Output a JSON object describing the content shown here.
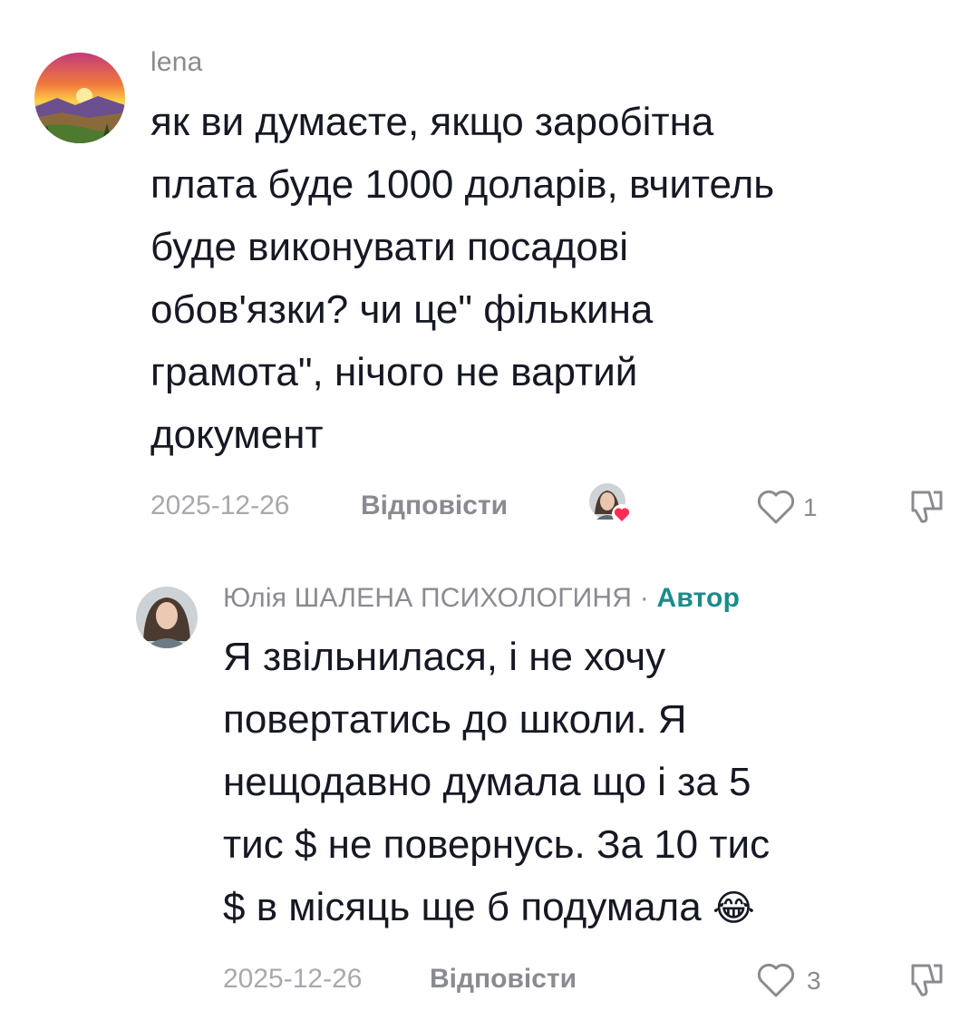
{
  "comment": {
    "username": "lena",
    "text": "як ви думаєте, якщо заробітна плата буде 1000 доларів, вчитель буде виконувати посадові обов'язки? чи це\" фількина грамота\", нічого не вартий документ",
    "lines": [
      "як ви думаєте, якщо заробітна",
      "плата буде 1000 доларів, вчитель",
      "буде виконувати посадові",
      "обов'язки? чи це\" фількина",
      "грамота\", нічого не вартий",
      "документ"
    ],
    "date": "2025-12-26",
    "reply_label": "Відповісти",
    "like_count": "1",
    "icons": [
      "avatar-sunset",
      "liked-by-creator-avatar",
      "heart-icon",
      "dislike-icon"
    ]
  },
  "reply": {
    "username": "Юлія ШАЛЕНА ПСИХОЛОГИНЯ",
    "separator": "·",
    "author_badge": "Автор",
    "lines": [
      "Я звільнилася, і не хочу",
      "повертатись до школи. Я",
      "нещодавно думала що і за 5",
      "тис $ не повернусь. За 10 тис",
      "$ в місяць ще б подумала"
    ],
    "emoji": "😂",
    "date": "2025-12-26",
    "reply_label": "Відповісти",
    "like_count": "3",
    "icons": [
      "avatar-woman",
      "heart-icon",
      "dislike-icon"
    ]
  },
  "colors": {
    "author_badge": "#1a8c8a",
    "secondary_text": "#8a8b91",
    "heart_badge": "#fe2c55"
  }
}
